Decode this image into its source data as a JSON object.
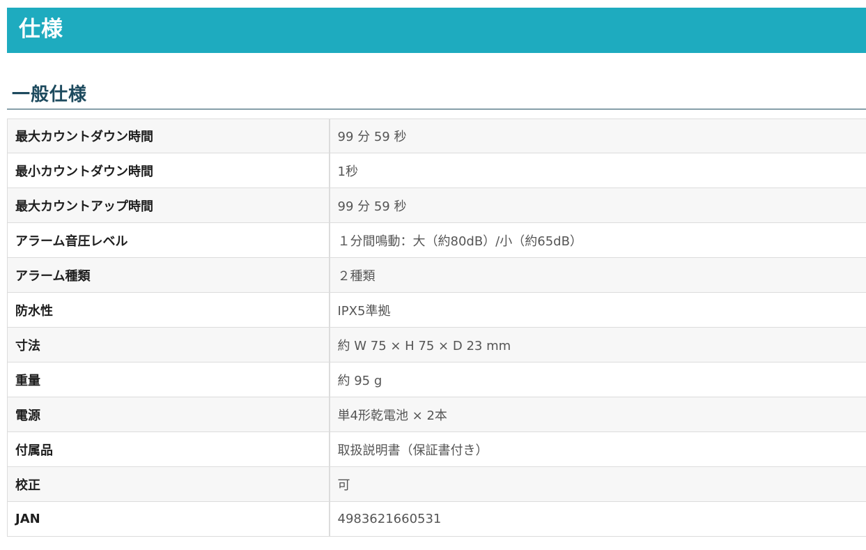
{
  "header": {
    "title": "仕様",
    "color": "#1eabbf"
  },
  "section": {
    "title": "一般仕様"
  },
  "specs": [
    {
      "label": "最大カウントダウン時間",
      "value": "99 分 59 秒"
    },
    {
      "label": "最小カウントダウン時間",
      "value": "1秒"
    },
    {
      "label": "最大カウントアップ時間",
      "value": "99 分 59 秒"
    },
    {
      "label": "アラーム音圧レベル",
      "value": "１分間鳴動：大（約80dB）/小（約65dB）"
    },
    {
      "label": "アラーム種類",
      "value": "２種類"
    },
    {
      "label": "防水性",
      "value": "IPX5準拠"
    },
    {
      "label": "寸法",
      "value": "約 W 75 × H 75 × D 23 mm"
    },
    {
      "label": "重量",
      "value": "約 95 g"
    },
    {
      "label": "電源",
      "value": "単4形乾電池 × 2本"
    },
    {
      "label": "付属品",
      "value": "取扱説明書（保証書付き）"
    },
    {
      "label": "校正",
      "value": "可"
    },
    {
      "label": "JAN",
      "value": "4983621660531"
    }
  ]
}
